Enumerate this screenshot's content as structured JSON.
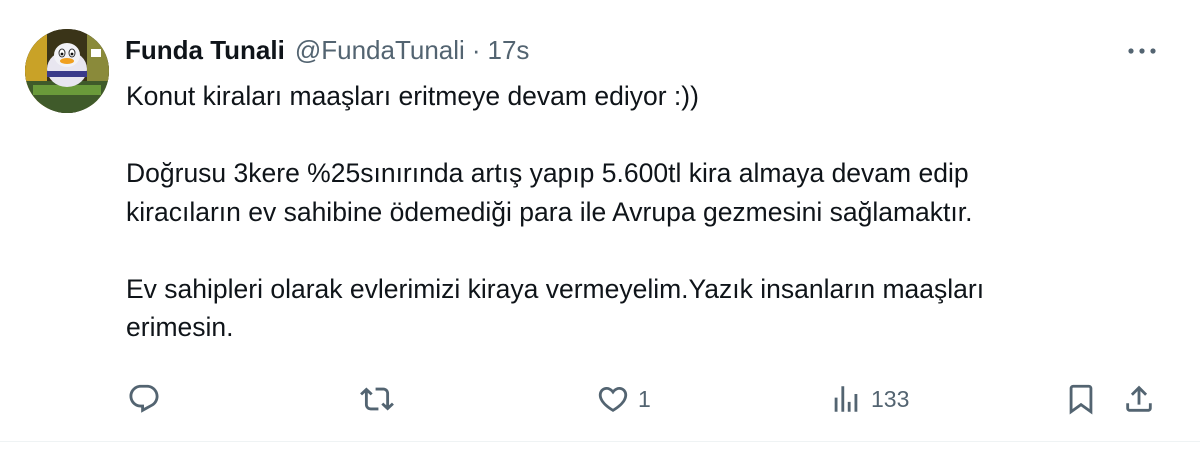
{
  "tweet": {
    "author_name": "Funda Tunali",
    "handle": "@FundaTunali",
    "separator": "·",
    "time": "17s",
    "paragraphs": [
      "Konut kiraları maaşları eritmeye devam ediyor :))",
      "Doğrusu 3kere %25sınırında artış yapıp 5.600tl kira almaya devam edip\nkiracıların ev sahibine ödemediği para ile Avrupa gezmesini sağlamaktır.",
      "Ev sahipleri olarak evlerimizi kiraya vermeyelim.Yazık insanların maaşları\nerimesin."
    ]
  },
  "actions": {
    "reply_icon": "reply-icon",
    "retweet_icon": "retweet-icon",
    "like_icon": "heart-icon",
    "like_count": "1",
    "views_icon": "views-icon",
    "views_count": "133",
    "bookmark_icon": "bookmark-icon",
    "share_icon": "share-icon"
  },
  "colors": {
    "text_primary": "#0f1419",
    "text_secondary": "#536471",
    "divider": "#eff3f4"
  }
}
